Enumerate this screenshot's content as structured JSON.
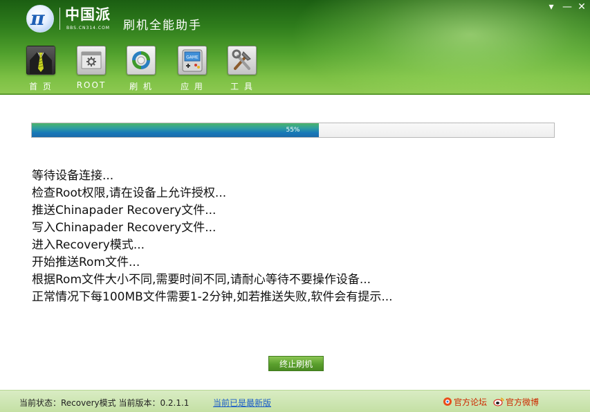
{
  "window": {
    "brand": "中国派",
    "brand_sub": "BBS.CN314.COM",
    "logo_mark": "π",
    "title": "刷机全能助手",
    "controls": {
      "menu": "▾",
      "minimize": "—",
      "close": "✕"
    }
  },
  "nav": {
    "items": [
      {
        "label": "首 页",
        "icon": "suit-tie-icon"
      },
      {
        "label": "ROOT",
        "icon": "root-gear-icon"
      },
      {
        "label": "刷 机",
        "icon": "refresh-flash-icon"
      },
      {
        "label": "应 用",
        "icon": "game-apps-icon"
      },
      {
        "label": "工 具",
        "icon": "tools-icon"
      }
    ],
    "apps_icon_text": "GAME"
  },
  "progress": {
    "value": 0.55,
    "label": "55%",
    "colors": {
      "fill": "#1777b8",
      "track": "#eeeeee"
    }
  },
  "log": {
    "lines": [
      "等待设备连接...",
      "检查Root权限,请在设备上允许授权...",
      "推送Chinapader Recovery文件...",
      "写入Chinapader Recovery文件...",
      "进入Recovery模式...",
      "开始推送Rom文件...",
      "根据Rom文件大小不同,需要时间不同,请耐心等待不要操作设备...",
      "正常情况下每100MB文件需要1-2分钟,如若推送失败,软件会有提示..."
    ]
  },
  "actions": {
    "stop_label": "终止刷机"
  },
  "status": {
    "text": "当前状态：Recovery模式 当前版本：0.2.1.1",
    "update_link": "当前已是最新版",
    "forum_link": "官方论坛",
    "weibo_link": "官方微博"
  },
  "colors": {
    "header_dark": "#1b5e12",
    "header_light": "#8fca52",
    "status_bar": "#c4e0a4",
    "link": "#1a5cc8",
    "footer_link": "#cc2a00"
  }
}
